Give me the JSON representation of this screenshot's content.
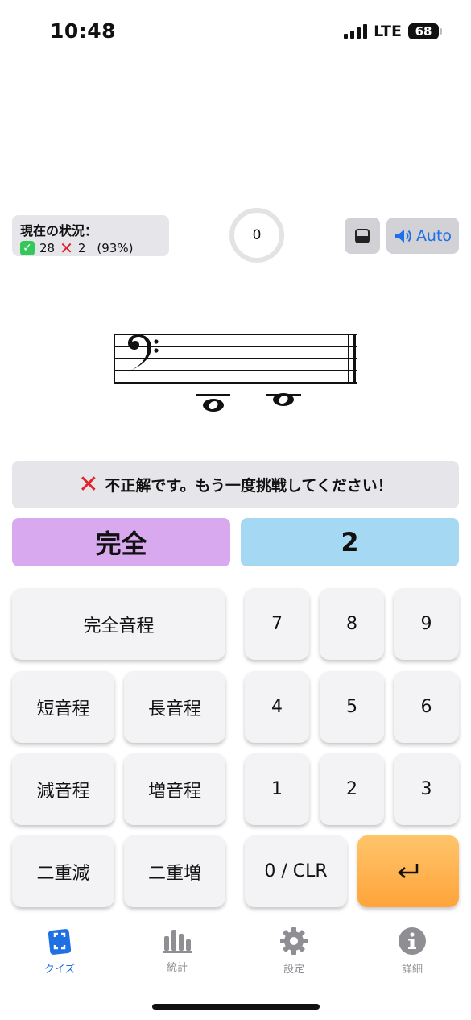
{
  "statusbar": {
    "time": "10:48",
    "network": "LTE",
    "battery": "68"
  },
  "status_panel": {
    "title": "現在の状況：",
    "correct": "28",
    "wrong": "2",
    "percent": "(93%)"
  },
  "timer": "0",
  "audio_button": {
    "label": "Auto"
  },
  "message": "不正解です。もう一度挑戦してください！",
  "answer": {
    "quality": "完全",
    "number": "2"
  },
  "keypad": {
    "perfect": "完全音程",
    "minor": "短音程",
    "major": "長音程",
    "diminished": "減音程",
    "augmented": "増音程",
    "double_dim": "二重減",
    "double_aug": "二重増",
    "digits": [
      "7",
      "8",
      "9",
      "4",
      "5",
      "6",
      "1",
      "2",
      "3"
    ],
    "clear": "0 / CLR",
    "enter_icon": "return-arrow-icon"
  },
  "tabs": [
    {
      "label": "クイズ",
      "icon": "quiz-card-icon",
      "active": true
    },
    {
      "label": "統計",
      "icon": "bar-chart-icon",
      "active": false
    },
    {
      "label": "設定",
      "icon": "gear-icon",
      "active": false
    },
    {
      "label": "詳細",
      "icon": "info-icon",
      "active": false
    }
  ],
  "colors": {
    "accent": "#1f6fe5",
    "quality_bg": "#d8a9ef",
    "number_bg": "#a4d8f3",
    "enter_bg": "#ffa43a",
    "error": "#e0202a"
  }
}
